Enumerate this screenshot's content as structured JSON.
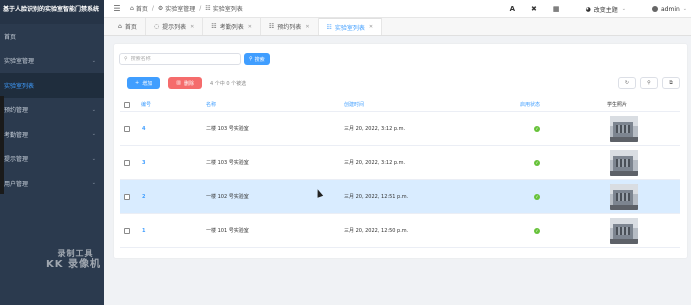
{
  "app": {
    "title": "基于人脸识别的实验室智能门禁系统"
  },
  "sidebar": {
    "items": [
      {
        "label": "首页",
        "has_children": false
      },
      {
        "label": "实验室管理",
        "has_children": true
      },
      {
        "label": "实验室列表",
        "has_children": false,
        "sub": true,
        "active": true
      },
      {
        "label": "预约管理",
        "has_children": true
      },
      {
        "label": "考勤管理",
        "has_children": true
      },
      {
        "label": "提示管理",
        "has_children": true
      },
      {
        "label": "用户管理",
        "has_children": true
      }
    ],
    "watermark_line1": "录制工具",
    "watermark_line2": "KK 录像机"
  },
  "header": {
    "breadcrumb": [
      "首页",
      "实验室管理",
      "实验室列表"
    ],
    "icon_a": "A",
    "icon_tools": "✖",
    "theme_label": "改变主题",
    "user_name": "admin"
  },
  "tabs": [
    {
      "label": "首页",
      "icon": "home-icon",
      "closable": false,
      "active": false
    },
    {
      "label": "提示列表",
      "icon": "chat-icon",
      "closable": true,
      "active": false
    },
    {
      "label": "考勤列表",
      "icon": "list-icon",
      "closable": true,
      "active": false
    },
    {
      "label": "预约列表",
      "icon": "list-icon",
      "closable": true,
      "active": false
    },
    {
      "label": "实验室列表",
      "icon": "list-icon",
      "closable": true,
      "active": true
    }
  ],
  "toolbar": {
    "search_placeholder": "搜索名称",
    "search_button": "搜索",
    "add_button": "增加",
    "delete_button": "删除",
    "selection_text": "4 个中 0 个被选"
  },
  "table": {
    "columns": [
      "编号",
      "名称",
      "创建时间",
      "启用状态",
      "学生照片"
    ],
    "rows": [
      {
        "id": "4",
        "name": "二楼 103 号实验室",
        "created": "三月 20, 2022, 3:12 p.m.",
        "enabled": true,
        "highlight": false
      },
      {
        "id": "3",
        "name": "二楼 103 号实验室",
        "created": "三月 20, 2022, 3:12 p.m.",
        "enabled": true,
        "highlight": false
      },
      {
        "id": "2",
        "name": "一楼 102 号实验室",
        "created": "三月 20, 2022, 12:51 p.m.",
        "enabled": true,
        "highlight": true
      },
      {
        "id": "1",
        "name": "一楼 101 号实验室",
        "created": "三月 20, 2022, 12:50 p.m.",
        "enabled": true,
        "highlight": false
      }
    ]
  },
  "colors": {
    "primary": "#409eff",
    "danger": "#f56c6c",
    "success": "#67c23a",
    "sidebar_bg": "#2b3a4e",
    "row_highlight": "#d9ecff"
  }
}
